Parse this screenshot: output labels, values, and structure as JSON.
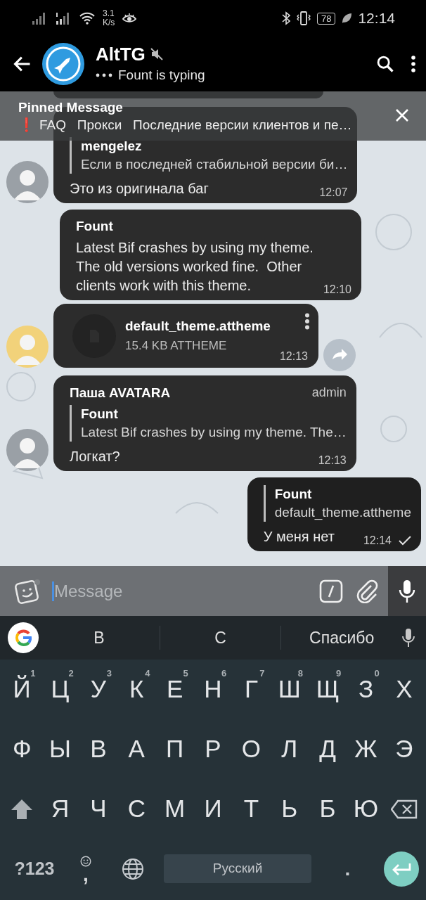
{
  "status_bar": {
    "speed_value": "3.1",
    "speed_unit": "K/s",
    "battery": "78",
    "time": "12:14"
  },
  "header": {
    "title": "AltTG",
    "muted": true,
    "subtitle": "Fount is typing"
  },
  "pinned": {
    "title": "Pinned Message",
    "mark": "❗",
    "text": "FAQ   Прокси   Последние версии клиентов и пе…"
  },
  "messages": [
    {
      "kind": "text",
      "outgoing": false,
      "color": "#9aa0a6",
      "reply": {
        "name": "mengelez",
        "text": "Если в последней стабильной версии би…"
      },
      "text": "Это из оригинала баг",
      "time": "12:07"
    },
    {
      "kind": "text",
      "outgoing": false,
      "sender": "Fount",
      "text": "Latest Bif crashes by using my theme.\nThe old versions worked fine.  Other\nclients work with this theme.",
      "time": "12:10"
    },
    {
      "kind": "file",
      "outgoing": false,
      "color": "#f2d27a",
      "file_name": "default_theme.attheme",
      "file_size": "15.4 KB ATTHEME",
      "time": "12:13"
    },
    {
      "kind": "text",
      "outgoing": false,
      "color": "#9aa0a6",
      "sender": "Паша AVATARA",
      "badge": "admin",
      "reply": {
        "name": "Fount",
        "text": "Latest Bif crashes by using my theme.  The…"
      },
      "text": "Логкат?",
      "time": "12:13"
    },
    {
      "kind": "text",
      "outgoing": true,
      "reply": {
        "name": "Fount",
        "text": "default_theme.attheme"
      },
      "text": "У меня нет",
      "time": "12:14",
      "sent": true
    }
  ],
  "composer": {
    "placeholder": "Message"
  },
  "keyboard": {
    "suggestions": [
      "В",
      "С",
      "Спасибо"
    ],
    "rows": [
      [
        {
          "kind": "char",
          "label": "Й",
          "hint": "1"
        },
        {
          "kind": "char",
          "label": "Ц",
          "hint": "2"
        },
        {
          "kind": "char",
          "label": "У",
          "hint": "3"
        },
        {
          "kind": "char",
          "label": "К",
          "hint": "4"
        },
        {
          "kind": "char",
          "label": "Е",
          "hint": "5"
        },
        {
          "kind": "char",
          "label": "Н",
          "hint": "6"
        },
        {
          "kind": "char",
          "label": "Г",
          "hint": "7"
        },
        {
          "kind": "char",
          "label": "Ш",
          "hint": "8"
        },
        {
          "kind": "char",
          "label": "Щ",
          "hint": "9"
        },
        {
          "kind": "char",
          "label": "З",
          "hint": "0"
        },
        {
          "kind": "char",
          "label": "Х"
        }
      ],
      [
        {
          "kind": "char",
          "label": "Ф"
        },
        {
          "kind": "char",
          "label": "Ы"
        },
        {
          "kind": "char",
          "label": "В"
        },
        {
          "kind": "char",
          "label": "А"
        },
        {
          "kind": "char",
          "label": "П"
        },
        {
          "kind": "char",
          "label": "Р"
        },
        {
          "kind": "char",
          "label": "О"
        },
        {
          "kind": "char",
          "label": "Л"
        },
        {
          "kind": "char",
          "label": "Д"
        },
        {
          "kind": "char",
          "label": "Ж"
        },
        {
          "kind": "char",
          "label": "Э"
        }
      ],
      [
        {
          "kind": "shift"
        },
        {
          "kind": "char",
          "label": "Я"
        },
        {
          "kind": "char",
          "label": "Ч"
        },
        {
          "kind": "char",
          "label": "С"
        },
        {
          "kind": "char",
          "label": "М"
        },
        {
          "kind": "char",
          "label": "И"
        },
        {
          "kind": "char",
          "label": "Т"
        },
        {
          "kind": "char",
          "label": "Ь"
        },
        {
          "kind": "char",
          "label": "Б"
        },
        {
          "kind": "char",
          "label": "Ю"
        },
        {
          "kind": "backspace"
        }
      ]
    ],
    "bottom_row": [
      {
        "kind": "symbols",
        "label": "?123"
      },
      {
        "kind": "comma",
        "label": ","
      },
      {
        "kind": "globe"
      },
      {
        "kind": "space",
        "label": "Русский"
      },
      {
        "kind": "period",
        "label": "."
      },
      {
        "kind": "enter"
      }
    ]
  }
}
